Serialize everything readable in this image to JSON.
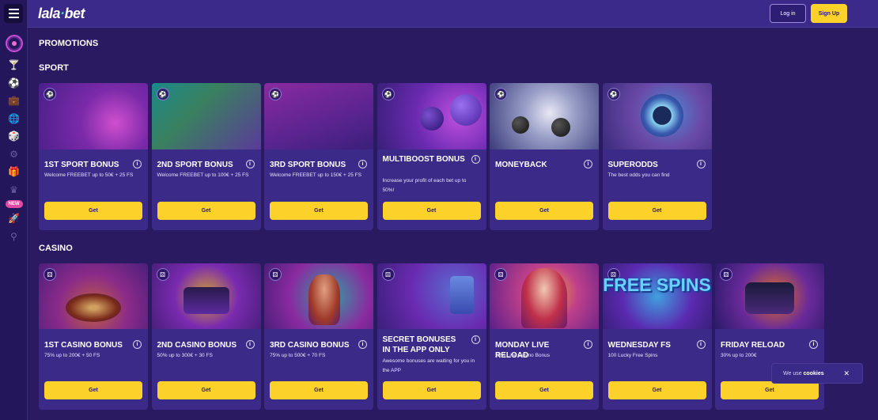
{
  "header": {
    "logo_prefix": "lala",
    "logo_suffix": "bet",
    "login_label": "Log in",
    "signup_label": "Sign Up"
  },
  "sidebar": {
    "new_badge": "NEW",
    "icons": [
      "casino-icon",
      "cocktail-icon",
      "sport-ball-icon",
      "briefcase-icon",
      "globe-icon",
      "dice-icon",
      "football-icon",
      "gift-icon",
      "crown-icon",
      "rocket-icon",
      "user-search-icon"
    ]
  },
  "page": {
    "title": "PROMOTIONS",
    "sport_heading": "SPORT",
    "casino_heading": "CASINO"
  },
  "sport": [
    {
      "title": "1ST SPORT BONUS",
      "desc": "Welcome FREEBET up to 50€ + 25 FS",
      "button": "Get"
    },
    {
      "title": "2ND SPORT BONUS",
      "desc": "Welcome FREEBET up to 100€ + 25 FS",
      "button": "Get"
    },
    {
      "title": "3RD SPORT BONUS",
      "desc": "Welcome FREEBET up to 150€ + 25 FS",
      "button": "Get"
    },
    {
      "title": "MULTIBOOST BONUS",
      "desc": "Increase your profit of each bet up to 50%!",
      "button": "Get"
    },
    {
      "title": "MONEYBACK",
      "desc": "",
      "button": "Get"
    },
    {
      "title": "SUPERODDS",
      "desc": "The best odds you can find",
      "button": "Get"
    }
  ],
  "casino": [
    {
      "title": "1ST CASINO BONUS",
      "desc": "75% up to 200€ + 50 FS",
      "button": "Get"
    },
    {
      "title": "2ND CASINO BONUS",
      "desc": "50% up to 300€ + 30 FS",
      "button": "Get"
    },
    {
      "title": "3RD CASINO BONUS",
      "desc": "75% up to 500€ + 70 FS",
      "button": "Get"
    },
    {
      "title": "SECRET BONUSES IN THE APP ONLY",
      "desc": "Awesome bonuses are waiting for you in the APP",
      "button": "Get"
    },
    {
      "title": "MONDAY LIVE RELOAD",
      "desc": "25% Live Casino Bonus",
      "button": "Get"
    },
    {
      "title": "WEDNESDAY FS",
      "desc": "100 Lucky Free Spins",
      "button": "Get",
      "image_text": "FREE SPINS"
    },
    {
      "title": "FRIDAY RELOAD",
      "desc": "30% up to 200€",
      "button": "Get"
    }
  ],
  "cookie": {
    "text": "We use",
    "link": "cookies",
    "close": "✕"
  },
  "colors": {
    "background": "#2a1a62",
    "topbar": "#3b2a8a",
    "card": "#3b2a88",
    "accent_yellow": "#fcd22a",
    "logo_accent": "#38d3b4"
  }
}
